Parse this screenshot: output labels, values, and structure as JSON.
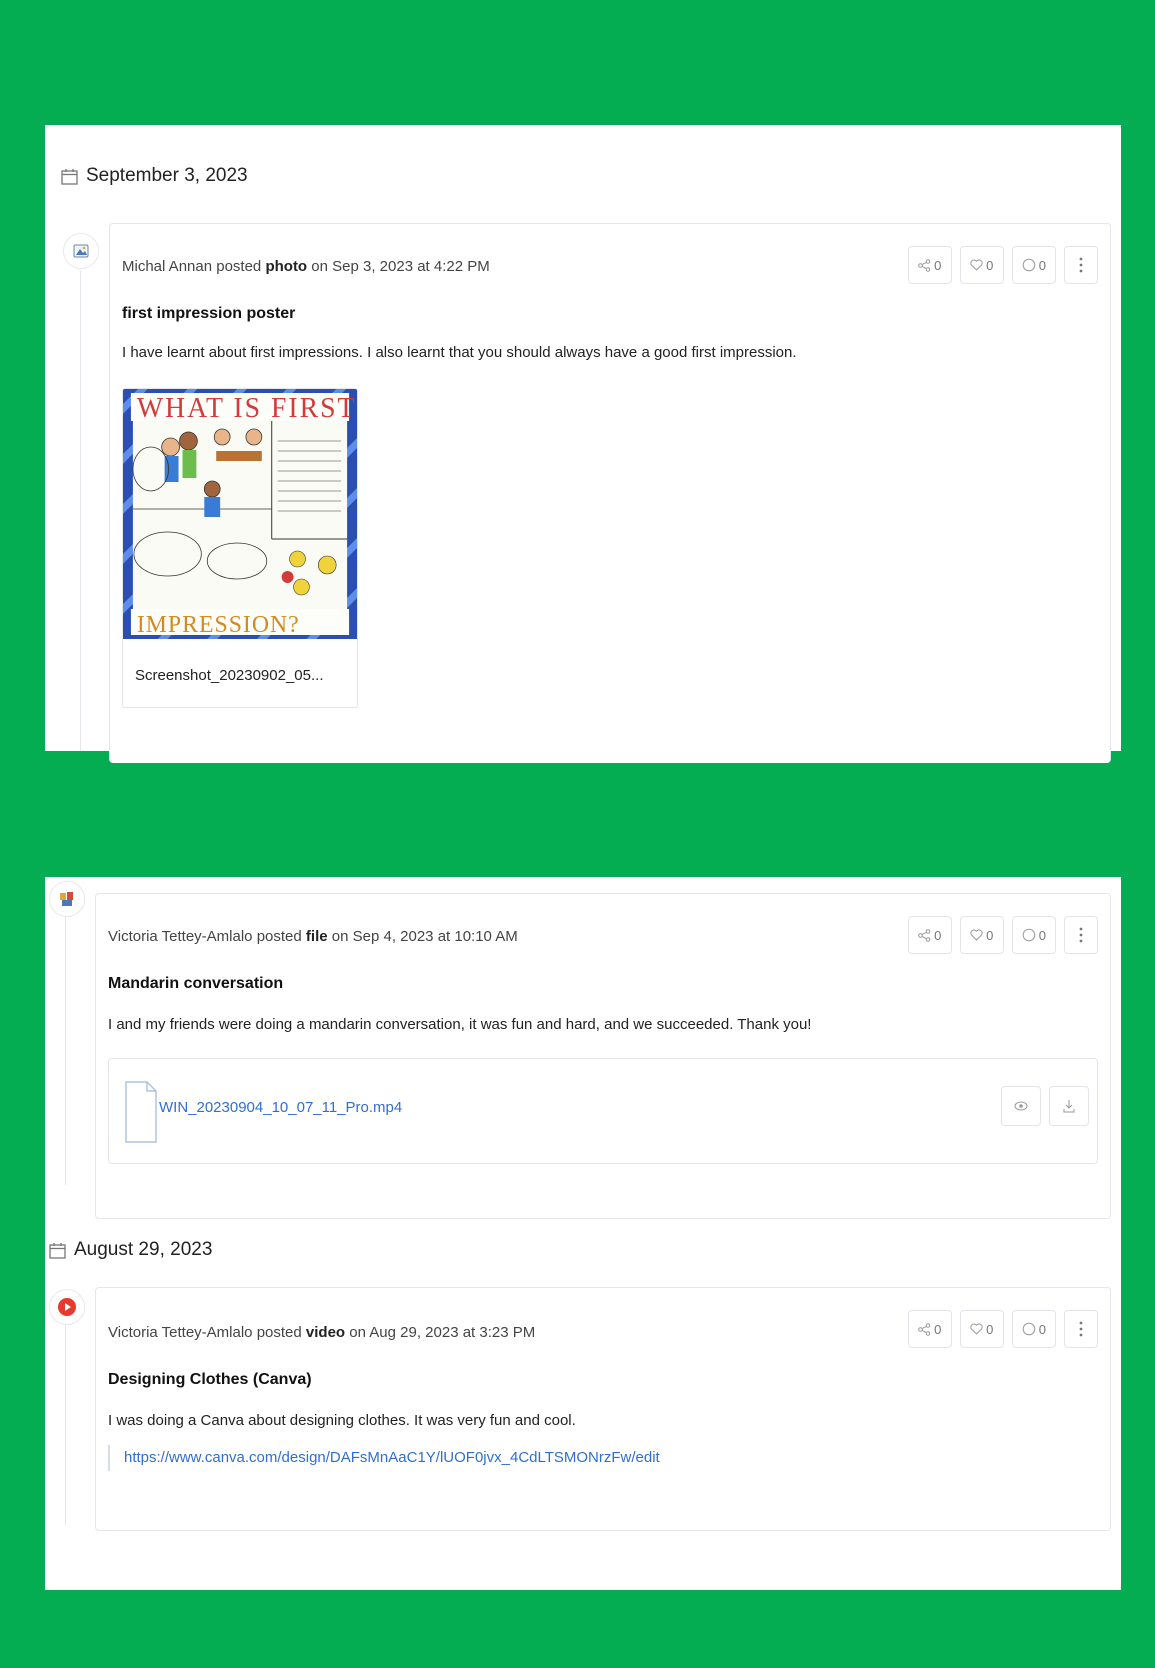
{
  "groups": [
    {
      "date": "September 3, 2023",
      "post": {
        "author": "Michal Annan",
        "posted_word": "posted",
        "type": "photo",
        "when": "on Sep 3, 2023 at 4:22 PM",
        "title": "first impression poster",
        "body": "I have learnt about first impressions. I also learnt that you should always have a good first impression.",
        "attachment_name": "Screenshot_20230902_05...",
        "shares": "0",
        "likes": "0",
        "comments": "0"
      }
    },
    {
      "post": {
        "author": "Victoria Tettey-Amlalo",
        "posted_word": "posted",
        "type": "file",
        "when": "on Sep 4, 2023 at 10:10 AM",
        "title": "Mandarin conversation",
        "body": "I and my friends were doing a mandarin conversation, it was fun and hard, and we succeeded. Thank you!",
        "file_name": "WIN_20230904_10_07_11_Pro.mp4",
        "shares": "0",
        "likes": "0",
        "comments": "0"
      }
    },
    {
      "date": "August 29, 2023",
      "post": {
        "author": "Victoria Tettey-Amlalo",
        "posted_word": "posted",
        "type": "video",
        "when": "on Aug 29, 2023 at 3:23 PM",
        "title": "Designing Clothes (Canva)",
        "body": "I was doing a Canva about designing clothes. It was very fun and cool.",
        "link": "https://www.canva.com/design/DAFsMnAaC1Y/lUOF0jvx_4CdLTSMONrzFw/edit",
        "shares": "0",
        "likes": "0",
        "comments": "0"
      }
    }
  ],
  "icons": {
    "calendar": "calendar-icon",
    "share": "share-icon",
    "like": "heart-icon",
    "comment": "comment-icon",
    "more": "more-vertical-icon",
    "photo_type": "image-icon",
    "file_type": "file-icon",
    "video_type": "play-icon",
    "view": "eye-icon",
    "download": "download-icon"
  },
  "colors": {
    "background": "#04ad51",
    "link": "#2f6fd1",
    "video_badge": "#e63a2e"
  }
}
